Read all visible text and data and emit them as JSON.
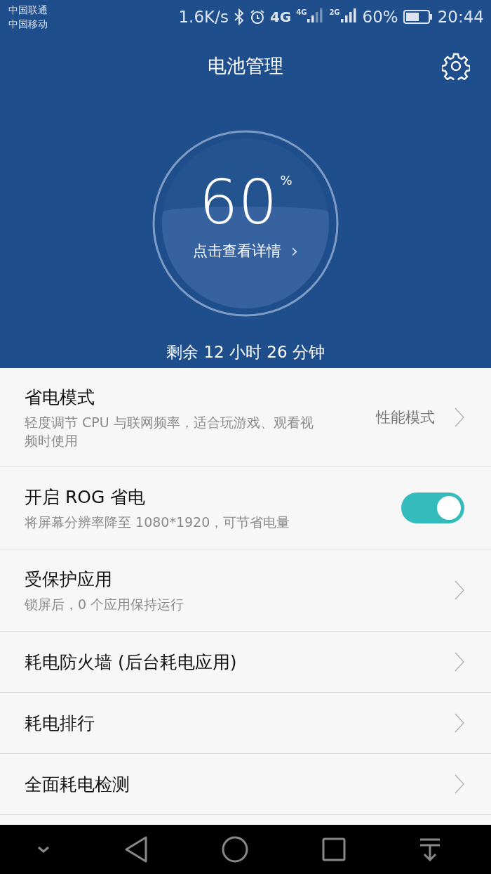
{
  "status_bar": {
    "carriers": [
      "中国联通",
      "中国移动"
    ],
    "speed": "1.6K/s",
    "network_1": "4G",
    "network_1_signal": "4G",
    "network_2": "2G",
    "battery": "60%",
    "time": "20:44"
  },
  "header": {
    "title": "电池管理"
  },
  "gauge": {
    "percent": "60",
    "unit": "%",
    "level": 0.6,
    "link": "点击查看详情",
    "chevron": "›"
  },
  "remaining": "剩余 12 小时 26 分钟",
  "rows": [
    {
      "kind": "link",
      "title": "省电模式",
      "subtitle": "轻度调节 CPU 与联网频率，适合玩游戏、观看视频时使用",
      "value": "性能模式"
    },
    {
      "kind": "toggle",
      "title": "开启 ROG 省电",
      "subtitle": "将屏幕分辨率降至 1080*1920，可节省电量",
      "on": true
    },
    {
      "kind": "link",
      "title": "受保护应用",
      "subtitle": "锁屏后，0 个应用保持运行"
    },
    {
      "kind": "link",
      "title": "耗电防火墙 (后台耗电应用)"
    },
    {
      "kind": "link",
      "title": "耗电排行"
    },
    {
      "kind": "link",
      "title": "全面耗电检测"
    }
  ]
}
